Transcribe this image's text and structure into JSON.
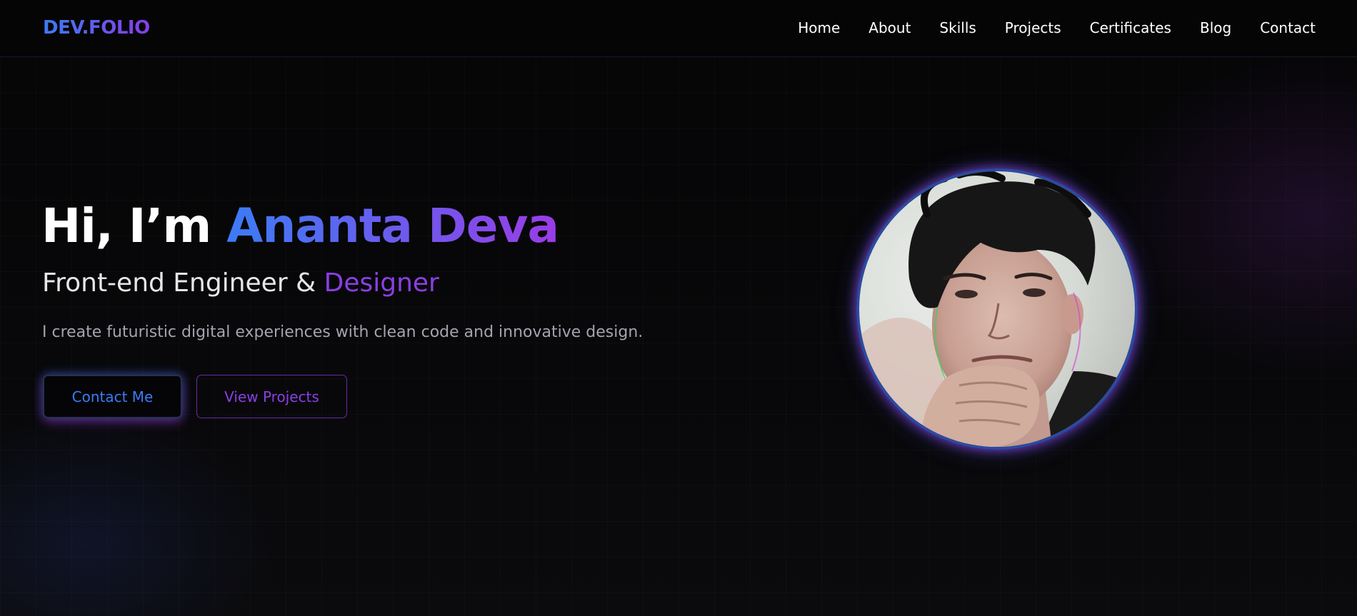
{
  "brand": {
    "logo_text": "DEV.FOLIO",
    "gradient_start": "#3b7cf4",
    "gradient_end": "#8a3ce8"
  },
  "nav": {
    "items": [
      {
        "label": "Home"
      },
      {
        "label": "About"
      },
      {
        "label": "Skills"
      },
      {
        "label": "Projects"
      },
      {
        "label": "Certificates"
      },
      {
        "label": "Blog"
      },
      {
        "label": "Contact"
      }
    ]
  },
  "hero": {
    "greeting": "Hi, I’m ",
    "name": "Ananta Deva",
    "subtitle_prefix": "Front-end Engineer & ",
    "subtitle_accent": "Designer",
    "description": "I create futuristic digital experiences with clean code and innovative design.",
    "primary_button": "Contact Me",
    "secondary_button": "View Projects",
    "accent_blue": "#3b7cf4",
    "accent_purple": "#8b3fe3"
  },
  "profile": {
    "photo_icon": "profile-photo"
  }
}
